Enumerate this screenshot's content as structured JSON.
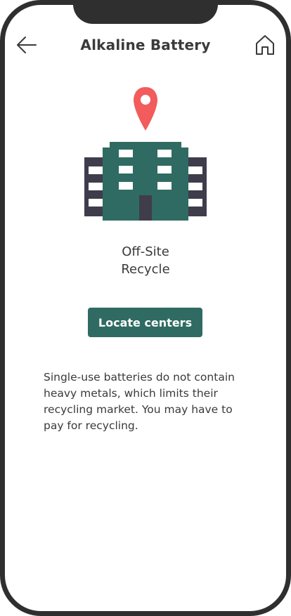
{
  "header": {
    "title": "Alkaline Battery",
    "back_icon": "arrow-left-icon",
    "home_icon": "home-icon"
  },
  "illustration": {
    "pin_icon": "location-pin-icon",
    "building_icon": "office-building-icon",
    "colors": {
      "pin": "#f25c5c",
      "building_main": "#2f6b62",
      "building_side": "#3f3c4b",
      "windows": "#ffffff",
      "door": "#3f3c4b"
    }
  },
  "location": {
    "line1": "Off-Site",
    "line2": "Recycle"
  },
  "actions": {
    "locate_label": "Locate centers"
  },
  "info": {
    "description": "Single-use batteries do not contain heavy metals, which limits their recycling market. You may have to pay for recycling."
  },
  "theme": {
    "accent": "#2f6b62",
    "text": "#3a3a3a",
    "frame": "#2e2f2e"
  }
}
